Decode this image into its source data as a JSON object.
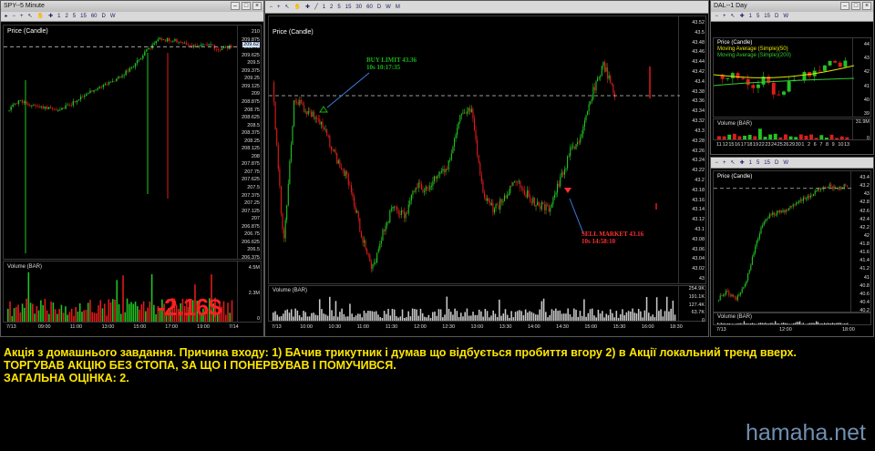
{
  "windows": {
    "left": {
      "title": "SPY--5 Minute",
      "price_label": "Price (Candle)",
      "price_ticks": [
        "210",
        "209.875",
        "209.75",
        "209.625",
        "209.5",
        "209.375",
        "209.25",
        "209.125",
        "209",
        "208.875",
        "208.75",
        "208.625",
        "208.5",
        "208.375",
        "208.25",
        "208.125",
        "208",
        "207.875",
        "207.75",
        "207.625",
        "207.5",
        "207.375",
        "207.25",
        "207.125",
        "207",
        "206.875",
        "206.75",
        "206.625",
        "206.5",
        "206.375"
      ],
      "volume_label": "Volume (BAR)",
      "volume_ticks": [
        "4.5M",
        "2.3M",
        "0"
      ],
      "x_ticks": [
        "7/13",
        "09:00",
        "11:00",
        "13:00",
        "15:00",
        "17:00",
        "19:00",
        "7/14"
      ],
      "current_price": "209.62"
    },
    "center": {
      "title": "",
      "price_label": "Price (Candle)",
      "price_ticks": [
        "43.52",
        "43.5",
        "43.48",
        "43.46",
        "43.44",
        "43.42",
        "43.4",
        "43.38",
        "43.36",
        "43.34",
        "43.32",
        "43.3",
        "43.28",
        "43.26",
        "43.24",
        "43.22",
        "43.2",
        "43.18",
        "43.16",
        "43.14",
        "43.12",
        "43.1",
        "43.08",
        "43.06",
        "43.04",
        "43.02",
        "43"
      ],
      "volume_label": "Volume (BAR)",
      "volume_ticks": [
        "254.9K",
        "191.1K",
        "127.4K",
        "63.7K",
        "0"
      ],
      "x_ticks": [
        "7/13",
        "10:00",
        "10:30",
        "11:00",
        "11:30",
        "12:00",
        "12:30",
        "13:00",
        "13:30",
        "14:00",
        "14:30",
        "15:00",
        "15:30",
        "16:00",
        "18:30"
      ],
      "buy_annotation": {
        "line1": "BUY LIMIT 43.36",
        "line2": "10s 10:17:35"
      },
      "sell_annotation": {
        "line1": "SELL MARKET 43.16",
        "line2": "10s 14:58:10"
      }
    },
    "right_top": {
      "title": "DAL--1 Day",
      "price_label": "Price (Candle)",
      "ma1": "Moving Average (Simple)(50)",
      "ma2": "Moving Average (Simple)(200)",
      "price_ticks": [
        "44",
        "43",
        "42",
        "41",
        "40",
        "39"
      ],
      "volume_label": "Volume (BAR)",
      "volume_ticks": [
        "31.9M",
        "0"
      ],
      "x_ticks": [
        "11",
        "12",
        "15",
        "16",
        "17",
        "18",
        "19",
        "22",
        "23",
        "24",
        "25",
        "26",
        "29",
        "30",
        "1",
        "2",
        "6",
        "7",
        "8",
        "9",
        "10",
        "13"
      ],
      "month_labels": [
        "JUN",
        "JUL"
      ]
    },
    "right_bottom": {
      "title": "",
      "price_label": "Price (Candle)",
      "price_ticks": [
        "43.4",
        "43.2",
        "43",
        "42.8",
        "42.6",
        "42.4",
        "42.2",
        "42",
        "41.8",
        "41.6",
        "41.4",
        "41.2",
        "41",
        "40.8",
        "40.6",
        "40.4",
        "40.2"
      ],
      "volume_label": "Volume (BAR)",
      "volume_ticks": [
        "2.3M",
        "0"
      ],
      "x_ticks": [
        "7/13",
        "12:00",
        "18:00"
      ]
    }
  },
  "pnl": "-2.16$",
  "caption": {
    "line1": "Акція з домашнього завдання. Причина входу: 1) БАчив трикутник і думав що відбується пробиття вгору 2) в Акції локальний тренд вверх.",
    "line2": "ТОРГУВАВ АКЦІЮ БЕЗ СТОПА, ЗА ЩО І ПОНЕРВУВАВ І ПОМУЧИВСЯ.",
    "line3": "ЗАГАЛЬНА ОЦІНКА: 2."
  },
  "watermark": "hamaha.net",
  "colors": {
    "up": "#22c322",
    "down": "#e01b1b",
    "caption": "#ffe600",
    "pnl": "#ff2020",
    "buy": "#18b418",
    "sell": "#ff3030"
  }
}
